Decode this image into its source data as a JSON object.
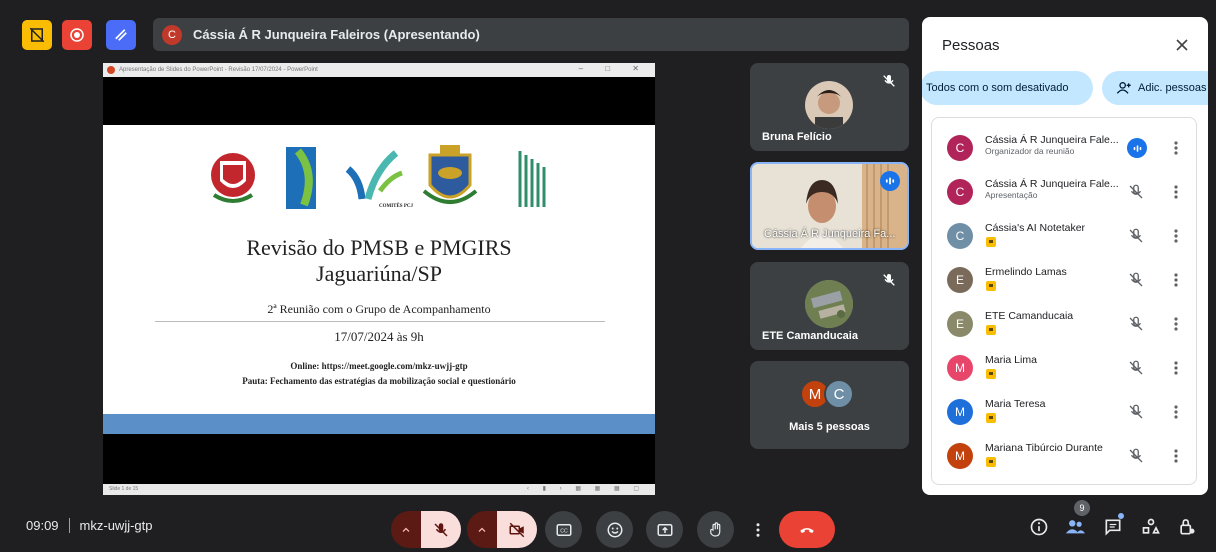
{
  "top_bar": {
    "presenter_initial": "C",
    "presenter_text": "Cássia Á R Junqueira Faleiros (Apresentando)",
    "icons": [
      "no-hand-icon",
      "record-icon",
      "rewrite-icon"
    ]
  },
  "presentation": {
    "titlebar_text": "Apresentação de Slides do PowerPoint - Revisão 17/07/2024 - PowerPoint",
    "slide": {
      "logo_caption": "COMITÊS PCJ",
      "title_line1": "Revisão do PMSB e PMGIRS",
      "title_line2": "Jaguariúna/SP",
      "subtitle": "2ª Reunião com o Grupo de Acompanhamento",
      "date": "17/07/2024 às 9h",
      "online": "Online: https://meet.google.com/mkz-uwjj-gtp",
      "pauta": "Pauta: Fechamento das estratégias da mobilização social e questionário"
    },
    "status_text": "Slide 1 de 15"
  },
  "tiles": [
    {
      "name": "Bruna Felício",
      "muted": true
    },
    {
      "name": "Cássia Á R Junqueira Fa...",
      "speaking": true
    },
    {
      "name": "ETE Camanducaia",
      "muted": true
    }
  ],
  "more_tile": {
    "initials": [
      "M",
      "C"
    ],
    "label": "Mais 5 pessoas"
  },
  "people_panel": {
    "title": "Pessoas",
    "mute_all": "Todos com o som desativado",
    "add_people": "Adic. pessoas",
    "participants": [
      {
        "initial": "C",
        "name": "Cássia Á R Junqueira Fale...",
        "sub": "Organizador da reunião",
        "color": "#b0245a",
        "mic": "speaking"
      },
      {
        "initial": "C",
        "name": "Cássia Á R Junqueira Fale...",
        "sub": "Apresentação",
        "color": "#b0245a",
        "mic": "muted"
      },
      {
        "initial": "C",
        "name": "Cássia's AI Notetaker",
        "sub": "",
        "color": "#6f8fa6",
        "mic": "muted"
      },
      {
        "initial": "E",
        "name": "Ermelindo Lamas",
        "sub": "",
        "color": "#7a6a5a",
        "mic": "muted"
      },
      {
        "initial": "E",
        "name": "ETE Camanducaia",
        "sub": "",
        "color": "#8a8a6a",
        "mic": "muted"
      },
      {
        "initial": "M",
        "name": "Maria Lima",
        "sub": "",
        "color": "#e8456b",
        "mic": "muted"
      },
      {
        "initial": "M",
        "name": "Maria Teresa",
        "sub": "",
        "color": "#1e6fd9",
        "mic": "muted"
      },
      {
        "initial": "M",
        "name": "Mariana Tibúrcio Durante",
        "sub": "",
        "color": "#c2410c",
        "mic": "muted"
      }
    ]
  },
  "bottom_bar": {
    "time": "09:09",
    "meeting_code": "mkz-uwjj-gtp",
    "people_count": "9"
  },
  "colors": {
    "background": "#1f1f21",
    "tile": "#3c4043",
    "accent": "#1a73e8",
    "end_call": "#ea4335",
    "chip": "#c2e7ff"
  }
}
